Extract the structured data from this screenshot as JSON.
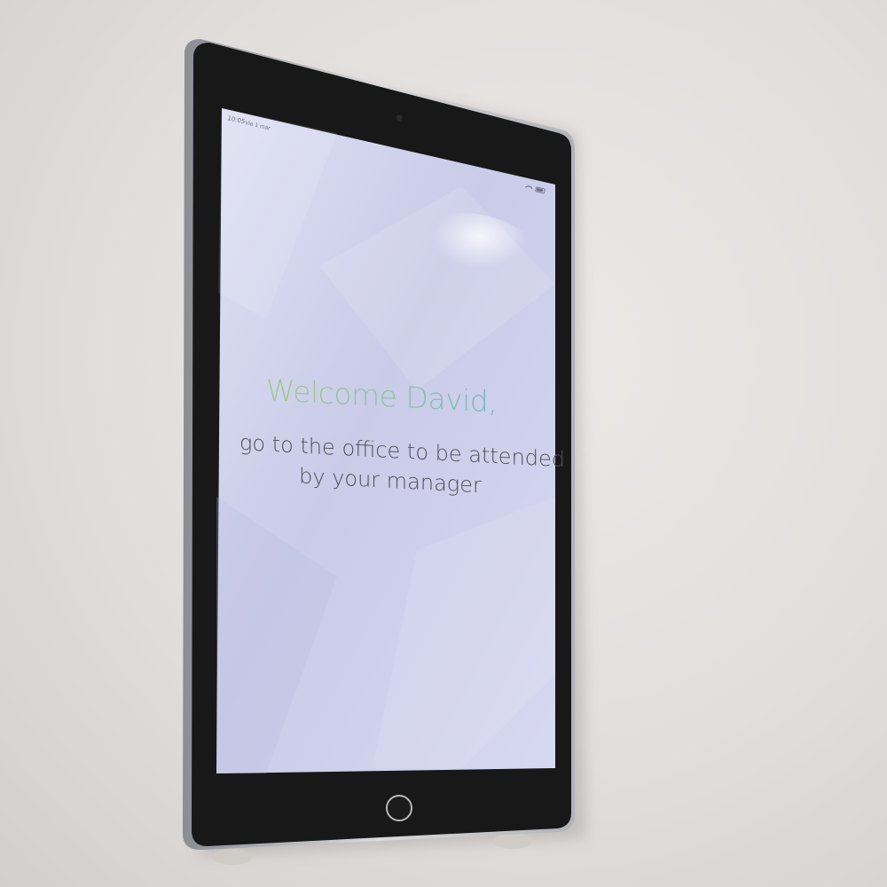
{
  "screen": {
    "status_time": "10:05",
    "status_date": "Vie 1 mar",
    "heading": "Welcome David,",
    "message_line1": "go to the office to be attended",
    "message_line2": "by your manager"
  }
}
